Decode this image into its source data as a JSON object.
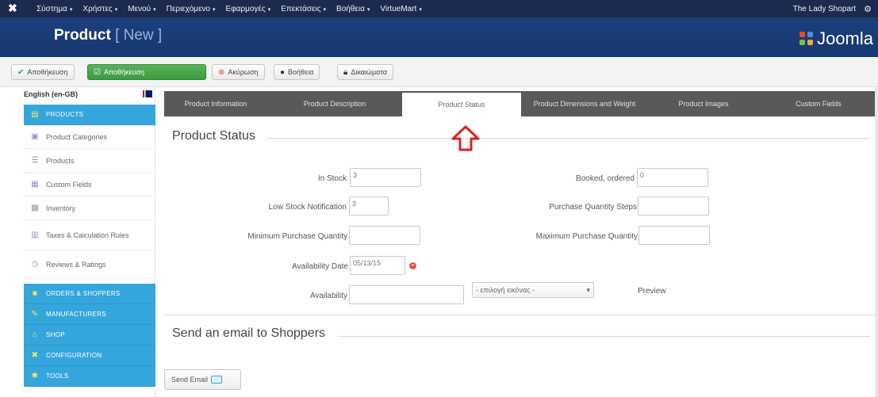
{
  "topbar": {
    "menu": [
      {
        "label": "Σύστημα",
        "caret": "▾"
      },
      {
        "label": "Χρήστες",
        "caret": "▾"
      },
      {
        "label": "Μενού",
        "caret": "▾"
      },
      {
        "label": "Περιεχόμενο",
        "caret": "▾"
      },
      {
        "label": "Εφαρμογές",
        "caret": "▾"
      },
      {
        "label": "Επεκτάσεις",
        "caret": "▾"
      },
      {
        "label": "Βοήθεια",
        "caret": "▾"
      },
      {
        "label": "VirtueMart",
        "caret": "▾"
      }
    ],
    "site_name": "The Lady Shopart"
  },
  "header": {
    "title": "Product",
    "subtitle": "[ New ]",
    "brand": "Joomla",
    "colors": {
      "bar": "#1b2a4e",
      "header": "#1c3f7d"
    }
  },
  "toolbar": {
    "buttons": [
      {
        "label": "Αποθήκευση",
        "icon": "check-icon",
        "style": "default"
      },
      {
        "label": "Αποθήκευση",
        "icon": "edit-icon",
        "style": "green"
      },
      {
        "label": "Ακύρωση",
        "icon": "cancel-icon",
        "style": "default"
      },
      {
        "label": "Βοήθεια",
        "icon": "help-icon",
        "style": "default"
      },
      {
        "label": "Δικαιώματα",
        "icon": "lock-icon",
        "style": "default"
      }
    ]
  },
  "sidebar": {
    "language": "English (en-GB)",
    "items": [
      {
        "label": "PRODUCTS",
        "icon": "products-icon",
        "style": "blue"
      },
      {
        "label": "Product Categories",
        "icon": "folder-icon",
        "style": "plain"
      },
      {
        "label": "Products",
        "icon": "list-icon",
        "style": "plain"
      },
      {
        "label": "Custom Fields",
        "icon": "fields-icon",
        "style": "plain"
      },
      {
        "label": "Inventory",
        "icon": "inventory-icon",
        "style": "plain"
      },
      {
        "label": "Taxes & Calculation Rules",
        "icon": "tax-icon",
        "style": "plain"
      },
      {
        "label": "Reviews & Ratings",
        "icon": "reviews-icon",
        "style": "plain"
      },
      {
        "label": "ORDERS & SHOPPERS",
        "icon": "orders-icon",
        "style": "blue"
      },
      {
        "label": "MANUFACTURERS",
        "icon": "manufacturer-icon",
        "style": "blue"
      },
      {
        "label": "SHOP",
        "icon": "shop-icon",
        "style": "blue"
      },
      {
        "label": "CONFIGURATION",
        "icon": "config-icon",
        "style": "blue"
      },
      {
        "label": "TOOLS",
        "icon": "tools-icon",
        "style": "blue"
      }
    ],
    "accent": "#35a6dc"
  },
  "tabs": [
    {
      "label": "Product Information",
      "active": false
    },
    {
      "label": "Product Description",
      "active": false
    },
    {
      "label": "Product Status",
      "active": true
    },
    {
      "label": "Product Dimensions and Weight",
      "active": false
    },
    {
      "label": "Product Images",
      "active": false
    },
    {
      "label": "Custom Fields",
      "active": false
    }
  ],
  "status": {
    "legend": "Product Status",
    "in_stock_label": "In Stock",
    "in_stock_value": "3",
    "booked_label": "Booked, ordered",
    "booked_value": "0",
    "low_stock_label": "Low Stock Notification",
    "low_stock_value": "3",
    "purchase_steps_label": "Purchase Quantity Steps",
    "purchase_steps_value": "",
    "min_qty_label": "Minimum Purchase Quantity",
    "min_qty_value": "",
    "max_qty_label": "Maximum Purchase Quantity",
    "max_qty_value": "",
    "availability_date_label": "Availability Date",
    "availability_date_value": "05/13/15",
    "availability_label": "Availability",
    "availability_value": "",
    "availability_select": "- επιλογή εικόνας -",
    "preview_label": "Preview"
  },
  "email": {
    "legend": "Send an email to Shoppers",
    "send_label": "Send Email"
  },
  "annotation": {
    "arrow_color": "#e02020"
  }
}
